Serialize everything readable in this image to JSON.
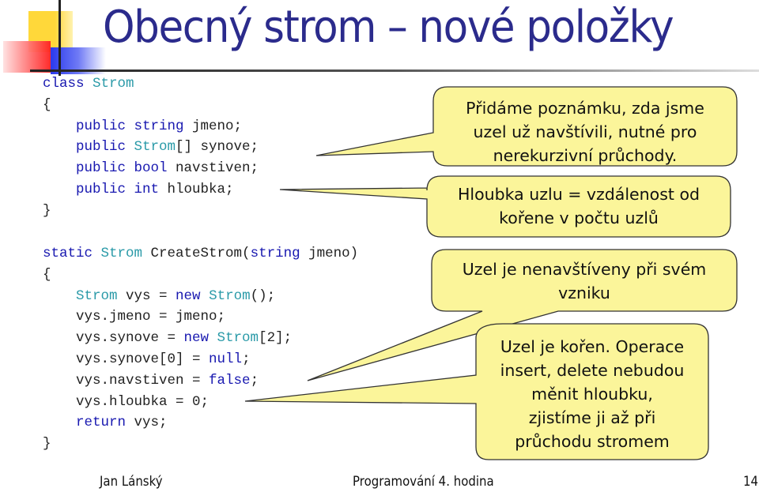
{
  "slide": {
    "title": "Obecný strom – nové položky",
    "code_block_1": [
      [
        {
          "t": "class ",
          "c": "kw"
        },
        {
          "t": "Strom",
          "c": "ty"
        }
      ],
      [
        {
          "t": "{",
          "c": ""
        }
      ],
      [
        {
          "t": "    public ",
          "c": "kw"
        },
        {
          "t": "string ",
          "c": "kw"
        },
        {
          "t": "jmeno;",
          "c": ""
        }
      ],
      [
        {
          "t": "    public ",
          "c": "kw"
        },
        {
          "t": "Strom",
          "c": "ty"
        },
        {
          "t": "[] synove;",
          "c": ""
        }
      ],
      [
        {
          "t": "    public ",
          "c": "kw"
        },
        {
          "t": "bool ",
          "c": "kw"
        },
        {
          "t": "navstiven;",
          "c": ""
        }
      ],
      [
        {
          "t": "    public ",
          "c": "kw"
        },
        {
          "t": "int ",
          "c": "kw"
        },
        {
          "t": "hloubka;",
          "c": ""
        }
      ],
      [
        {
          "t": "}",
          "c": ""
        }
      ]
    ],
    "code_block_2": [
      [
        {
          "t": "static ",
          "c": "kw"
        },
        {
          "t": "Strom ",
          "c": "ty"
        },
        {
          "t": "CreateStrom(",
          "c": ""
        },
        {
          "t": "string ",
          "c": "kw"
        },
        {
          "t": "jmeno)",
          "c": ""
        }
      ],
      [
        {
          "t": "{",
          "c": ""
        }
      ],
      [
        {
          "t": "    ",
          "c": ""
        },
        {
          "t": "Strom ",
          "c": "ty"
        },
        {
          "t": "vys = ",
          "c": ""
        },
        {
          "t": "new ",
          "c": "kw"
        },
        {
          "t": "Strom",
          "c": "ty"
        },
        {
          "t": "();",
          "c": ""
        }
      ],
      [
        {
          "t": "    vys.jmeno = jmeno;",
          "c": ""
        }
      ],
      [
        {
          "t": "    vys.synove = ",
          "c": ""
        },
        {
          "t": "new ",
          "c": "kw"
        },
        {
          "t": "Strom",
          "c": "ty"
        },
        {
          "t": "[2];",
          "c": ""
        }
      ],
      [
        {
          "t": "    vys.synove[0] = ",
          "c": ""
        },
        {
          "t": "null",
          "c": "kw"
        },
        {
          "t": ";",
          "c": ""
        }
      ],
      [
        {
          "t": "    vys.navstiven = ",
          "c": ""
        },
        {
          "t": "false",
          "c": "kw"
        },
        {
          "t": ";",
          "c": ""
        }
      ],
      [
        {
          "t": "    vys.hloubka = 0;",
          "c": ""
        }
      ],
      [
        {
          "t": "    ",
          "c": ""
        },
        {
          "t": "return ",
          "c": "kw"
        },
        {
          "t": "vys;",
          "c": ""
        }
      ],
      [
        {
          "t": "}",
          "c": ""
        }
      ]
    ],
    "callouts": [
      {
        "lines": [
          "Přidáme poznámku, zda jsme",
          "uzel už navštívili, nutné pro",
          "nerekurzivní průchody."
        ]
      },
      {
        "lines": [
          "Hloubka uzlu  = vzdálenost od",
          "kořene v počtu uzlů"
        ]
      },
      {
        "lines": [
          "Uzel je nenavštíveny při svém",
          "vzniku"
        ]
      },
      {
        "lines": [
          "Uzel je kořen. Operace",
          "insert, delete nebudou",
          "měnit hloubku,",
          "zjistíme ji až při",
          "průchodu stromem"
        ]
      }
    ],
    "colors": {
      "title": "#2b2b8c",
      "keyword": "#1818b0",
      "type": "#2a9aa8",
      "callout_fill": "#fbf59a",
      "callout_stroke": "#333333"
    }
  },
  "footer": {
    "author": "Jan Lánský",
    "course": "Programování 4. hodina",
    "page_number": "14"
  }
}
